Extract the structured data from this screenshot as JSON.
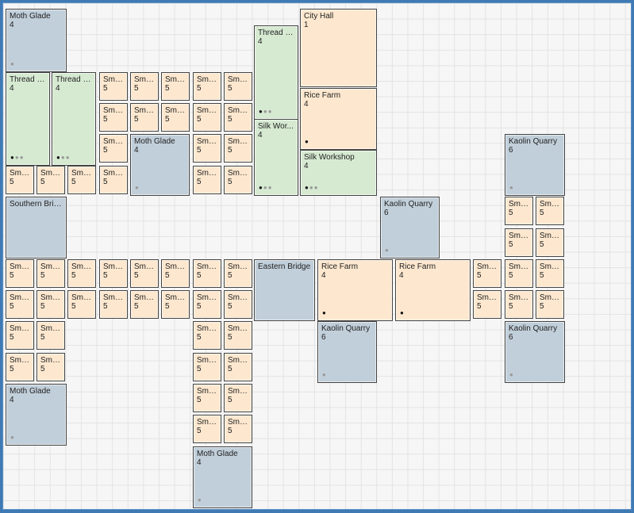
{
  "tiles": [
    {
      "name": "Moth Glade",
      "level": "4",
      "type": "blue",
      "dots": [
        "off"
      ]
    },
    {
      "name": "City Hall",
      "level": "1",
      "type": "orange",
      "dots": []
    },
    {
      "name": "Thread P...",
      "level": "4",
      "type": "green",
      "dots": [
        "on",
        "off",
        "off"
      ]
    },
    {
      "name": "Thread P...",
      "level": "4",
      "type": "green",
      "dots": [
        "on",
        "off",
        "off"
      ]
    },
    {
      "name": "Thread P...",
      "level": "4",
      "type": "green",
      "dots": [
        "on",
        "off",
        "off"
      ]
    },
    {
      "name": "Rice Farm",
      "level": "4",
      "type": "orange",
      "dots": [
        "on"
      ]
    },
    {
      "name": "Silk Wor...",
      "level": "4",
      "type": "green",
      "dots": [
        "on",
        "off",
        "off"
      ]
    },
    {
      "name": "Silk Workshop",
      "level": "4",
      "type": "green",
      "dots": [
        "on",
        "off",
        "off"
      ]
    },
    {
      "name": "Moth Glade",
      "level": "4",
      "type": "blue",
      "dots": [
        "off"
      ]
    },
    {
      "name": "Kaolin Quarry",
      "level": "6",
      "type": "blue",
      "dots": [
        "off"
      ]
    },
    {
      "name": "Southern Brid...",
      "level": "",
      "type": "blue",
      "dots": []
    },
    {
      "name": "Kaolin Quarry",
      "level": "6",
      "type": "blue",
      "dots": [
        "off"
      ]
    },
    {
      "name": "Eastern Bridge",
      "level": "",
      "type": "blue",
      "dots": []
    },
    {
      "name": "Rice Farm",
      "level": "4",
      "type": "orange",
      "dots": [
        "on"
      ]
    },
    {
      "name": "Rice Farm",
      "level": "4",
      "type": "orange",
      "dots": [
        "on"
      ]
    },
    {
      "name": "Kaolin Quarry",
      "level": "6",
      "type": "blue",
      "dots": [
        "off"
      ]
    },
    {
      "name": "Kaolin Quarry",
      "level": "6",
      "type": "blue",
      "dots": [
        "off"
      ]
    },
    {
      "name": "Moth Glade",
      "level": "4",
      "type": "blue",
      "dots": [
        "off"
      ]
    },
    {
      "name": "Moth Glade",
      "level": "4",
      "type": "blue",
      "dots": [
        "off"
      ]
    },
    {
      "name": "Sma...",
      "level": "5",
      "type": "orange",
      "dots": []
    }
  ]
}
